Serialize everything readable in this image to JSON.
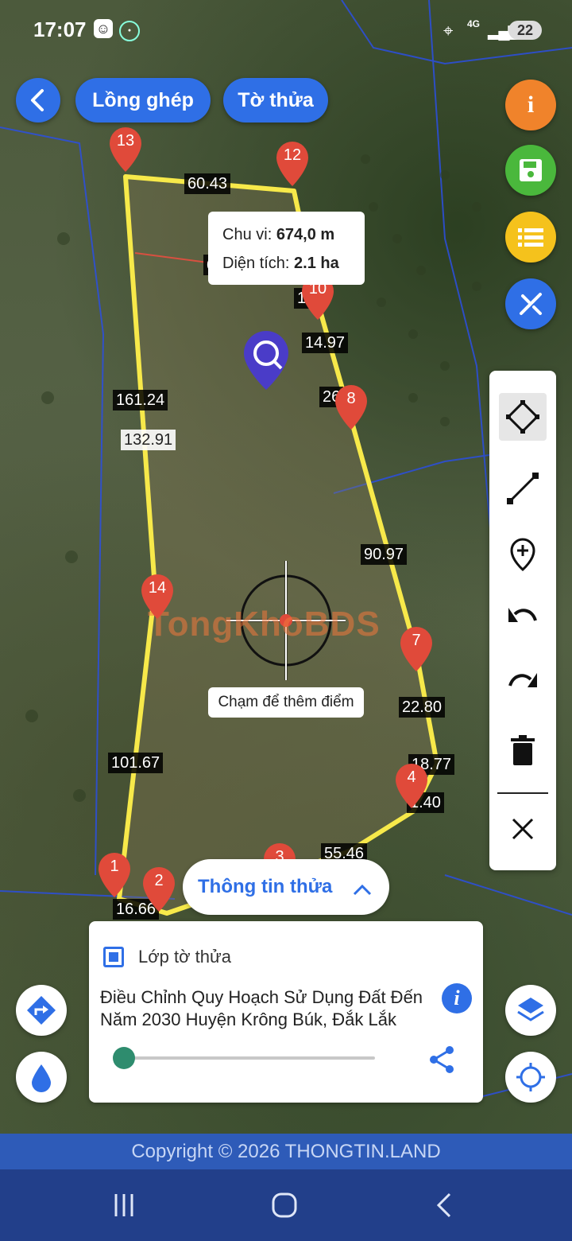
{
  "status_bar": {
    "time": "17:07",
    "network": "4G",
    "battery": "22"
  },
  "top_bar": {
    "back_icon": "back-arrow-icon",
    "overlay_button": "Lồng ghép",
    "sheet_button": "Tờ thửa"
  },
  "right_actions": [
    {
      "name": "info",
      "icon": "info-icon",
      "color": "#f0832b"
    },
    {
      "name": "save",
      "icon": "save-icon",
      "color": "#4ab83c"
    },
    {
      "name": "list",
      "icon": "list-icon",
      "color": "#f5c21c"
    },
    {
      "name": "edit",
      "icon": "ruler-pencil-icon",
      "color": "#2f6fe6"
    }
  ],
  "draw_tools": [
    "polygon-tool-icon",
    "line-tool-icon",
    "add-point-icon",
    "undo-icon",
    "redo-icon",
    "delete-icon",
    "close-icon"
  ],
  "measure": {
    "perimeter_label": "Chu vi: ",
    "perimeter_value": "674,0 m",
    "area_label": "Diện tích: ",
    "area_value": "2.1 ha"
  },
  "segment_labels": {
    "s13_12": "60.43",
    "s_left_outer": "161.24",
    "s_left_inner": "132.91",
    "s10": "14.97",
    "s8": "26",
    "s65": "65",
    "s_right": "90.97",
    "s7": "22.80",
    "s5": "18.77",
    "s4": "1.40",
    "s3": "55.46",
    "s_left_lower": "101.67",
    "s1": "16.66",
    "s10b": "1 2"
  },
  "pins": [
    "13",
    "12",
    "10",
    "8",
    "14",
    "7",
    "4",
    "3",
    "1",
    "2"
  ],
  "crosshair_hint": "Chạm để thêm điểm",
  "watermark": "TongKhoBDS",
  "parcel_info_button": "Thông tin thửa",
  "layer_card": {
    "layer_name": "Lớp tờ thửa",
    "description": "Điều Chỉnh Quy Hoạch Sử Dụng Đất Đến Năm 2030 Huyện Krông Búk, Đắk Lắk",
    "opacity": 0
  },
  "footer": {
    "copyright": "Copyright © 2026 THONGTIN.LAND"
  },
  "colors": {
    "accent": "#2f6fe6",
    "boundary": "#f7e94a",
    "pin": "#e04a3a"
  }
}
